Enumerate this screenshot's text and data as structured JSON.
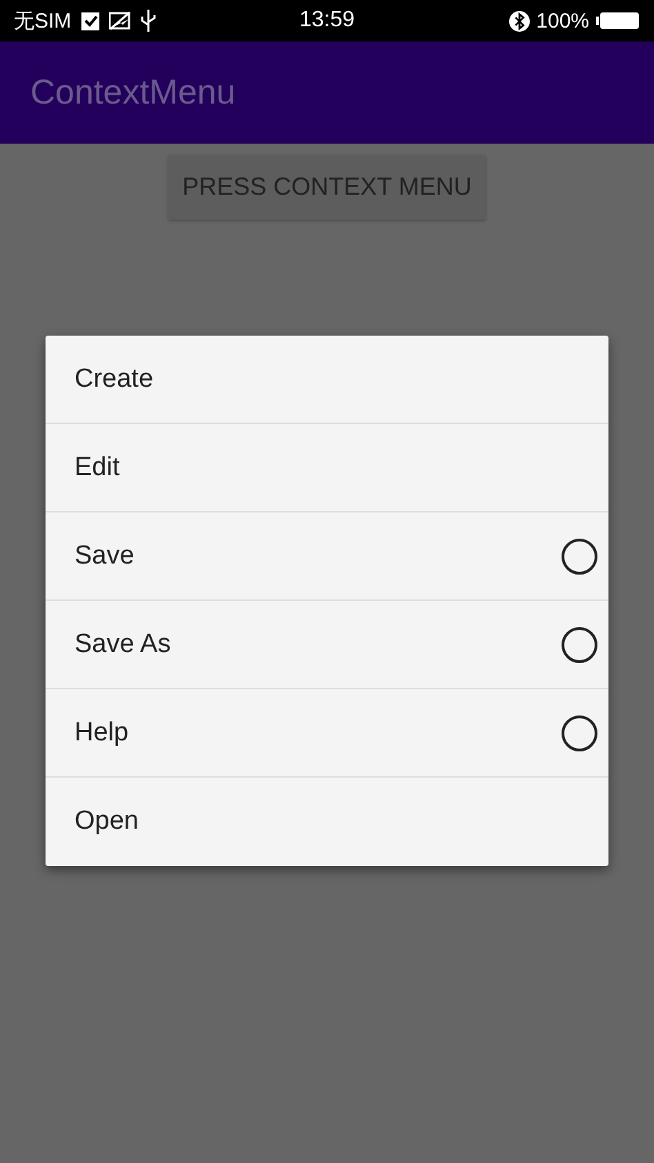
{
  "status_bar": {
    "carrier": "无SIM",
    "time": "13:59",
    "battery": "100%"
  },
  "app_bar": {
    "title": "ContextMenu"
  },
  "button": {
    "label": "PRESS CONTEXT MENU"
  },
  "context_menu": {
    "items": [
      {
        "label": "Create",
        "kind": "plain"
      },
      {
        "label": "Edit",
        "kind": "plain"
      },
      {
        "label": "Save",
        "kind": "radio",
        "selected": false
      },
      {
        "label": "Save As",
        "kind": "radio",
        "selected": false
      },
      {
        "label": "Help",
        "kind": "radio",
        "selected": false
      },
      {
        "label": "Open",
        "kind": "plain"
      }
    ]
  }
}
